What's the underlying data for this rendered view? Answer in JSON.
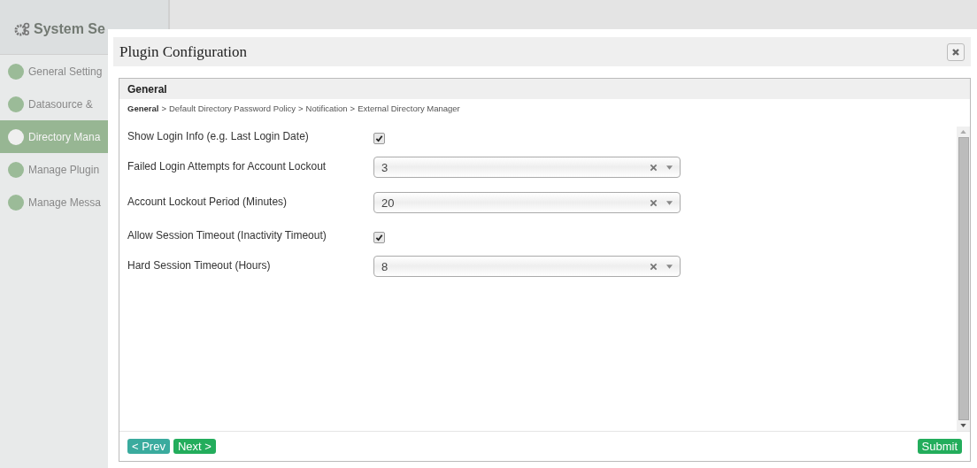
{
  "sidebar": {
    "title": "System Se",
    "items": [
      {
        "label": "General Setting",
        "selected": false
      },
      {
        "label": "Datasource &",
        "selected": false
      },
      {
        "label": "Directory Mana",
        "selected": true
      },
      {
        "label": "Manage Plugin",
        "selected": false
      },
      {
        "label": "Manage Messa",
        "selected": false
      }
    ]
  },
  "dialog": {
    "title": "Plugin Configuration",
    "panel_title": "General",
    "breadcrumb_separator": ">",
    "breadcrumb": [
      {
        "label": "General",
        "selected": true
      },
      {
        "label": "Default Directory Password Policy",
        "selected": false
      },
      {
        "label": "Notification",
        "selected": false
      },
      {
        "label": "External Directory Manager",
        "selected": false
      }
    ],
    "fields": [
      {
        "kind": "checkbox",
        "label": "Show Login Info (e.g. Last Login Date)",
        "checked": true
      },
      {
        "kind": "select",
        "label": "Failed Login Attempts for Account Lockout",
        "value": "3"
      },
      {
        "kind": "select",
        "label": "Account Lockout Period (Minutes)",
        "value": "20"
      },
      {
        "kind": "checkbox",
        "label": "Allow Session Timeout (Inactivity Timeout)",
        "checked": true
      },
      {
        "kind": "select",
        "label": "Hard Session Timeout (Hours)",
        "value": "8"
      }
    ],
    "buttons": {
      "prev": "< Prev",
      "next": "Next >",
      "submit": "Submit"
    }
  }
}
